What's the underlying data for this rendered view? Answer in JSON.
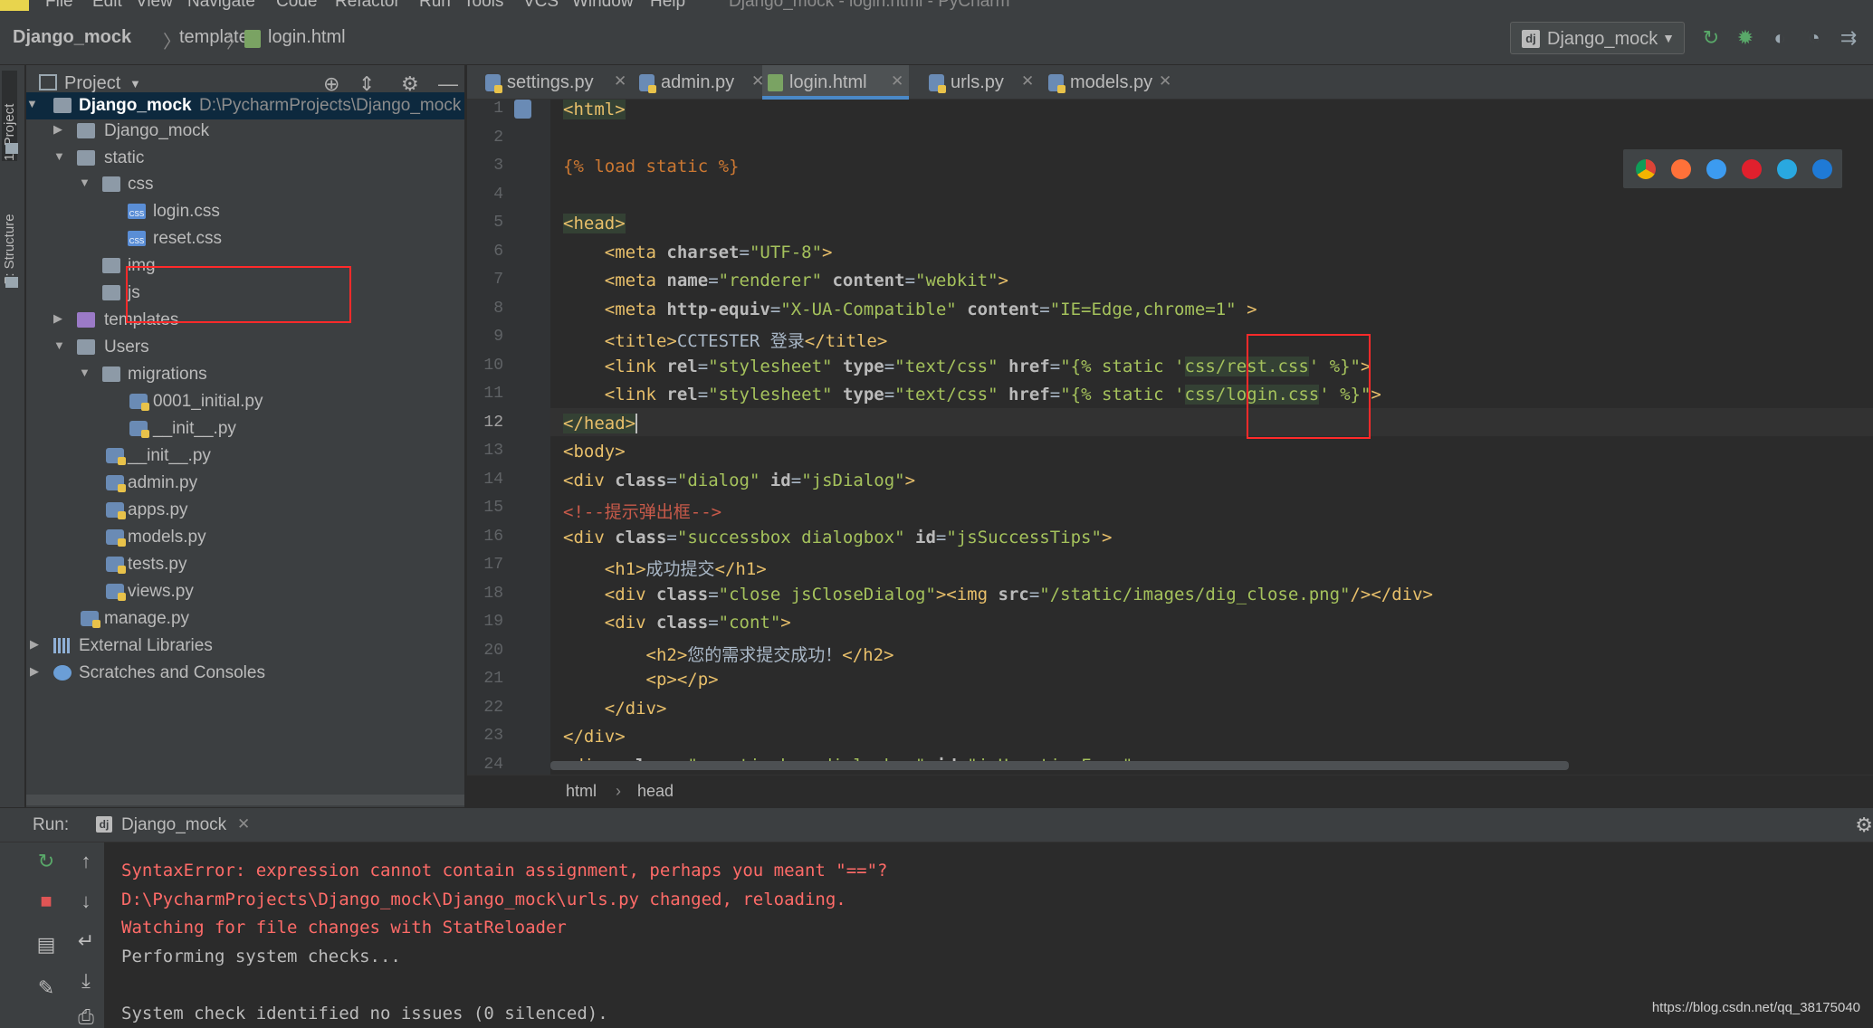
{
  "menubar": {
    "items": [
      "File",
      "Edit",
      "View",
      "Navigate",
      "Code",
      "Refactor",
      "Run",
      "Tools",
      "VCS",
      "Window",
      "Help"
    ],
    "title": "Django_mock - login.html - PyCharm"
  },
  "navbar": {
    "crumbs": [
      "Django_mock",
      "templates",
      "login.html"
    ],
    "run_config": "Django_mock"
  },
  "side_tabs": {
    "project": "1: Project",
    "structure": "7: Structure"
  },
  "project": {
    "header": "Project",
    "root_name": "Django_mock",
    "root_path": "D:\\PycharmProjects\\Django_mock",
    "items": [
      "Django_mock",
      "static",
      "css",
      "login.css",
      "reset.css",
      "img",
      "js",
      "templates",
      "Users",
      "migrations",
      "0001_initial.py",
      "__init__.py",
      "__init__.py",
      "admin.py",
      "apps.py",
      "models.py",
      "tests.py",
      "views.py",
      "manage.py",
      "External Libraries",
      "Scratches and Consoles"
    ]
  },
  "editor": {
    "tabs": [
      "settings.py",
      "admin.py",
      "login.html",
      "urls.py",
      "models.py"
    ],
    "active_tab": "login.html",
    "line_numbers": [
      "1",
      "2",
      "3",
      "4",
      "5",
      "6",
      "7",
      "8",
      "9",
      "10",
      "11",
      "12",
      "13",
      "14",
      "15",
      "16",
      "17",
      "18",
      "19",
      "20",
      "21",
      "22",
      "23",
      "24"
    ],
    "current_line": "12",
    "breadcrumb": [
      "html",
      "head"
    ],
    "browsers": [
      "chrome-icon",
      "firefox-icon",
      "safari-icon",
      "opera-icon",
      "ie-icon",
      "edge-icon"
    ]
  },
  "code": {
    "l1": "<html>",
    "l3": "{% load static %}",
    "l5": "<head>",
    "l6_tag": "<meta",
    "l6_a1": "charset",
    "l6_v1": "\"UTF-8\"",
    "l6_end": ">",
    "l7_tag": "<meta",
    "l7_a1": "name",
    "l7_v1": "\"renderer\"",
    "l7_a2": "content",
    "l7_v2": "\"webkit\"",
    "l7_end": ">",
    "l8_tag": "<meta",
    "l8_a1": "http-equiv",
    "l8_v1": "\"X-UA-Compatible\"",
    "l8_a2": "content",
    "l8_v2": "\"IE=Edge,chrome=1\"",
    "l8_end": " >",
    "l9_tag": "<title>",
    "l9_text": "CCTESTER 登录",
    "l9_end": "</title>",
    "l10_tag": "<link",
    "l10_a1": "rel",
    "l10_v1": "\"stylesheet\"",
    "l10_a2": "type",
    "l10_v2": "\"text/css\"",
    "l10_a3": "href",
    "l10_v3a": "\"{% static '",
    "l10_v3b": "css/rest.css",
    "l10_v3c": "' %}\"",
    "l10_end": ">",
    "l11_tag": "<link",
    "l11_a1": "rel",
    "l11_v1": "\"stylesheet\"",
    "l11_a2": "type",
    "l11_v2": "\"text/css\"",
    "l11_a3": "href",
    "l11_v3a": "\"{% static '",
    "l11_v3b": "css/login.css",
    "l11_v3c": "' %}\"",
    "l11_end": ">",
    "l12": "</head>",
    "l13": "<body>",
    "l14_tag": "<div",
    "l14_a1": "class",
    "l14_v1": "\"dialog\"",
    "l14_a2": "id",
    "l14_v2": "\"jsDialog\"",
    "l14_end": ">",
    "l15": "<!--提示弹出框-->",
    "l16_tag": "<div",
    "l16_a1": "class",
    "l16_v1": "\"successbox dialogbox\"",
    "l16_a2": "id",
    "l16_v2": "\"jsSuccessTips\"",
    "l16_end": ">",
    "l17_tag": "<h1>",
    "l17_text": "成功提交",
    "l17_end": "</h1>",
    "l18_tag": "<div",
    "l18_a1": "class",
    "l18_v1": "\"close jsCloseDialog\"",
    "l18_mid": "><img",
    "l18_a2": "src",
    "l18_v2": "\"/static/images/dig_close.png\"",
    "l18_end": "/></div>",
    "l19_tag": "<div",
    "l19_a1": "class",
    "l19_v1": "\"cont\"",
    "l19_end": ">",
    "l20_tag": "<h2>",
    "l20_text": "您的需求提交成功！",
    "l20_end": "</h2>",
    "l21": "<p></p>",
    "l22": "</div>",
    "l23": "</div>",
    "l24_tag": "<div",
    "l24_a1": "class",
    "l24_v1": "\"noactivebox dialogbox\"",
    "l24_a2": "id",
    "l24_v2": "\"jsUnactiveForm\"",
    "l24_end": " >"
  },
  "run": {
    "label": "Run:",
    "tab": "Django_mock",
    "lines": [
      "SyntaxError: expression cannot contain assignment, perhaps you meant \"==\"?",
      "D:\\PycharmProjects\\Django_mock\\Django_mock\\urls.py changed, reloading.",
      "Watching for file changes with StatReloader",
      "Performing system checks...",
      "System check identified no issues (0 silenced)."
    ]
  },
  "watermark": "https://blog.csdn.net/qq_38175040",
  "colors": {
    "background": "#2b2b2b",
    "panel": "#3c3f41",
    "tag": "#e8bf6a",
    "string": "#a5c25c",
    "error": "#ff6b68",
    "annotation_box": "#ff2a2a",
    "accent": "#4a88c7"
  }
}
